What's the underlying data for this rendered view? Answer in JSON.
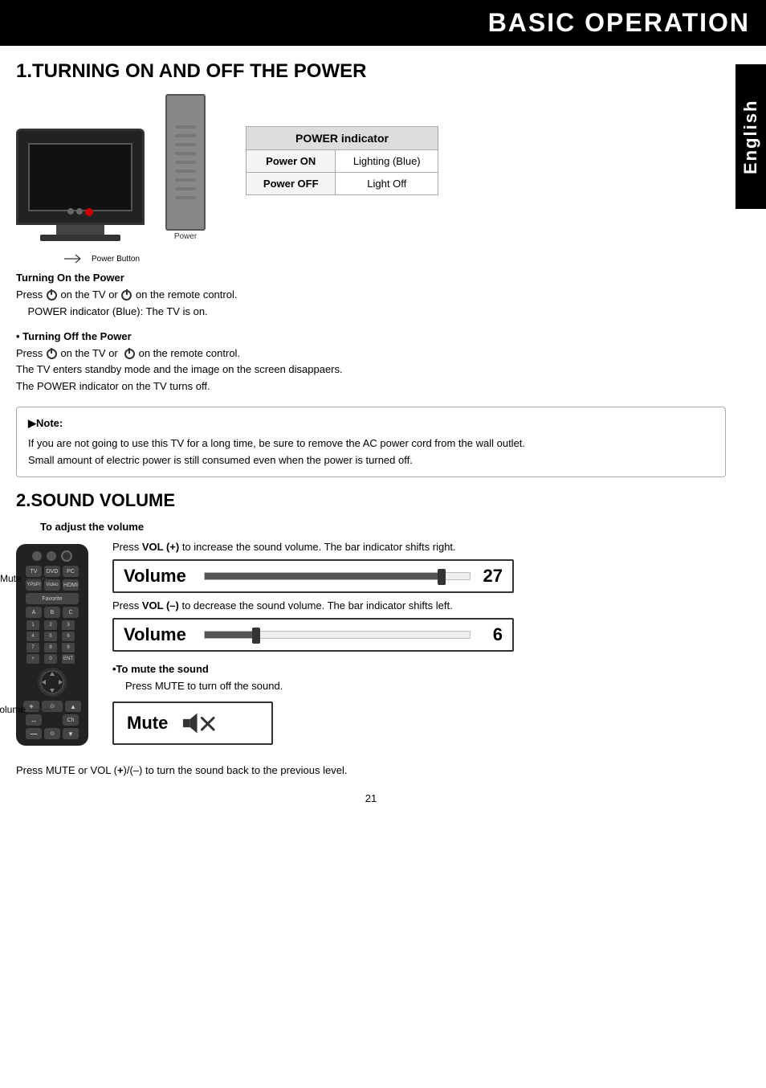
{
  "page": {
    "title": "BASIC OPERATION",
    "page_number": "21",
    "language_tab": "English"
  },
  "section1": {
    "heading": "1.TURNING ON AND OFF THE POWER",
    "power_indicator": {
      "title": "POWER indicator",
      "rows": [
        {
          "label": "Power ON",
          "value": "Lighting (Blue)"
        },
        {
          "label": "Power OFF",
          "value": "Light Off"
        }
      ]
    },
    "turning_on": {
      "heading": "Turning On the Power",
      "line1": "Press  on the TV or  on the remote control.",
      "line2": "POWER indicator (Blue): The TV is on."
    },
    "turning_off": {
      "heading": "• Turning Off the Power",
      "line1": "Press  on the TV or   on the remote control.",
      "line2": "The TV enters standby mode and the image on the screen disappaers.",
      "line3": "The POWER indicator on the TV turns off."
    },
    "note": {
      "heading": "▶Note:",
      "line1": "If you are not going to use this TV for a long time, be sure to remove the AC power cord from the wall outlet.",
      "line2": "Small amount of electric power is still consumed even when the power is turned off."
    },
    "labels": {
      "power_button": "Power Button",
      "power": "Power"
    }
  },
  "section2": {
    "heading": "2.SOUND VOLUME",
    "sub_heading": "To adjust the volume",
    "vol_high": {
      "description": "Press VOL (+) to increase the sound volume. The bar indicator shifts right.",
      "label": "Volume",
      "value": "27",
      "fill_pct": 88
    },
    "vol_low": {
      "description": "Press VOL (–) to decrease the sound volume. The bar indicator shifts left.",
      "label": "Volume",
      "value": "6",
      "fill_pct": 18
    },
    "mute": {
      "heading": "•To mute the sound",
      "instruction": "Press MUTE to turn off the sound.",
      "label": "Mute"
    },
    "bottom_note": "Press MUTE or VOL (+)/(–) to turn the sound back to the previous level.",
    "remote_labels": {
      "mute": "Mute",
      "volume": "Volume"
    }
  }
}
